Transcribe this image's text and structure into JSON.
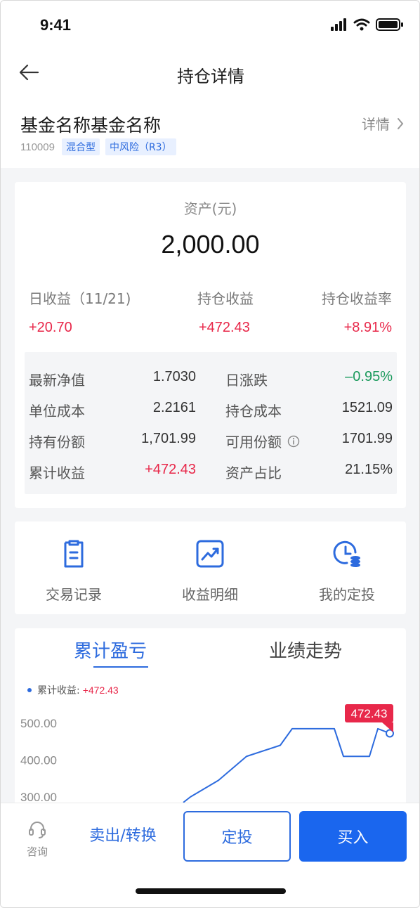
{
  "status_bar": {
    "time": "9:41"
  },
  "nav": {
    "title": "持仓详情"
  },
  "fund": {
    "name": "基金名称基金名称",
    "detail_label": "详情",
    "code": "110009",
    "tags": [
      "混合型",
      "中风险（R3）"
    ]
  },
  "asset": {
    "label": "资产(元)",
    "value": "2,000.00",
    "stats": [
      {
        "label": "日收益（11/21)",
        "value": "+20.70"
      },
      {
        "label": "持仓收益",
        "value": "+472.43"
      },
      {
        "label": "持仓收益率",
        "value": "+8.91%"
      }
    ],
    "grid": [
      {
        "label": "最新净值",
        "value": "1.7030"
      },
      {
        "label": "日涨跌",
        "value": "–0.95%"
      },
      {
        "label": "单位成本",
        "value": "2.2161"
      },
      {
        "label": "持仓成本",
        "value": "1521.09"
      },
      {
        "label": "持有份额",
        "value": "1,701.99"
      },
      {
        "label": "可用份额",
        "value": "1701.99"
      },
      {
        "label": "累计收益",
        "value": "+472.43"
      },
      {
        "label": "资产占比",
        "value": "21.15%"
      }
    ]
  },
  "actions": [
    {
      "label": "交易记录",
      "icon": "document-icon"
    },
    {
      "label": "收益明细",
      "icon": "trend-chart-icon"
    },
    {
      "label": "我的定投",
      "icon": "clock-coin-icon"
    }
  ],
  "chart_tabs": {
    "active": "累计盈亏",
    "inactive": "业绩走势"
  },
  "chart_data": {
    "type": "line",
    "legend_label": "累计收益:",
    "legend_value": "+472.43",
    "y_ticks": [
      "500.00",
      "400.00",
      "300.00"
    ],
    "ylim": [
      300,
      500
    ],
    "series": [
      {
        "values": [
          285,
          300,
          345,
          410,
          440,
          485,
          485,
          485,
          410,
          410,
          485,
          472.43
        ]
      }
    ],
    "tooltip": "472.43",
    "colors": {
      "line": "#2d6bde",
      "tooltip": "#e8284a"
    }
  },
  "bottom": {
    "consult_label": "咨询",
    "sell_label": "卖出/转换",
    "plan_label": "定投",
    "buy_label": "买入"
  },
  "colors": {
    "accent": "#2d6bde",
    "positive": "#e8284a",
    "negative": "#1a9a5c"
  }
}
